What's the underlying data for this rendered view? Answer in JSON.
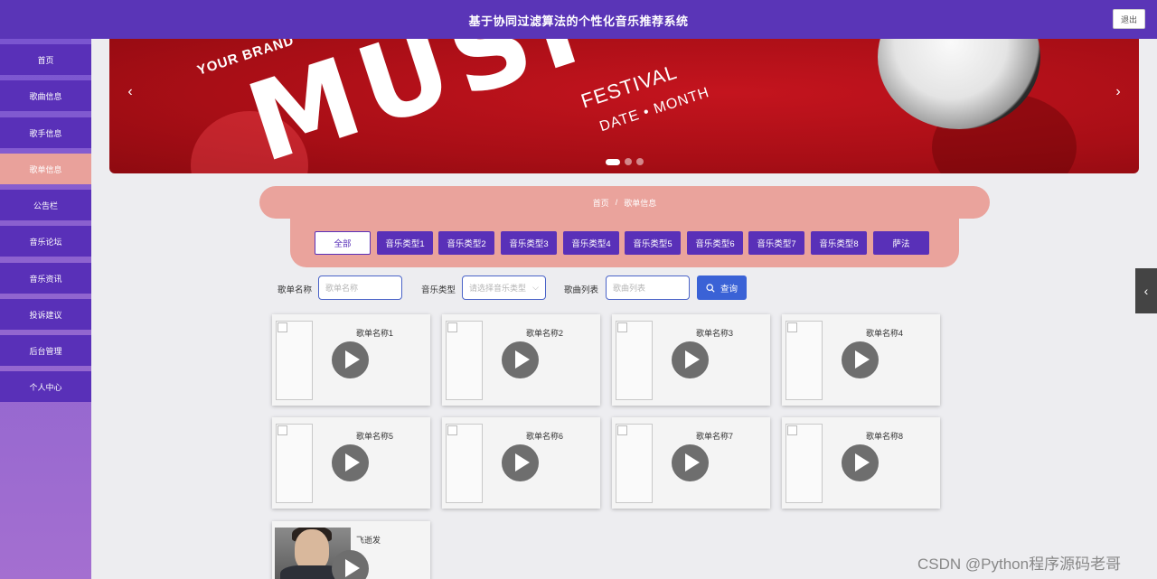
{
  "header": {
    "title": "基于协同过滤算法的个性化音乐推荐系统",
    "logout_label": "退出"
  },
  "sidebar": {
    "items": [
      {
        "label": "首页"
      },
      {
        "label": "歌曲信息"
      },
      {
        "label": "歌手信息"
      },
      {
        "label": "歌单信息",
        "active": true
      },
      {
        "label": "公告栏"
      },
      {
        "label": "音乐论坛"
      },
      {
        "label": "音乐资讯"
      },
      {
        "label": "投诉建议"
      },
      {
        "label": "后台管理"
      },
      {
        "label": "个人中心"
      }
    ]
  },
  "banner": {
    "brand_text": "YOUR BRAND",
    "main_text": "MUSI",
    "festival_text": "FESTIVAL",
    "date_text": "DATE • MONTH",
    "prev_icon": "‹",
    "next_icon": "›",
    "slide_count": 3,
    "active_slide": 1
  },
  "breadcrumb": {
    "home": "首页",
    "separator": "/",
    "current": "歌单信息"
  },
  "categories": [
    "全部",
    "音乐类型1",
    "音乐类型2",
    "音乐类型3",
    "音乐类型4",
    "音乐类型5",
    "音乐类型6",
    "音乐类型7",
    "音乐类型8",
    "萨法"
  ],
  "search": {
    "name_label": "歌单名称",
    "name_placeholder": "歌单名称",
    "type_label": "音乐类型",
    "type_placeholder": "请选择音乐类型",
    "list_label": "歌曲列表",
    "list_placeholder": "歌曲列表",
    "query_label": "查询"
  },
  "cards": [
    {
      "name": "歌单名称1"
    },
    {
      "name": "歌单名称2"
    },
    {
      "name": "歌单名称3"
    },
    {
      "name": "歌单名称4"
    },
    {
      "name": "歌单名称5"
    },
    {
      "name": "歌单名称6"
    },
    {
      "name": "歌单名称7"
    },
    {
      "name": "歌单名称8"
    },
    {
      "name": "飞逝发",
      "has_photo": true
    }
  ],
  "watermark": "CSDN @Python程序源码老哥",
  "colors": {
    "primary": "#5930b8",
    "accent": "#eaa39c",
    "query": "#3a62d6"
  }
}
